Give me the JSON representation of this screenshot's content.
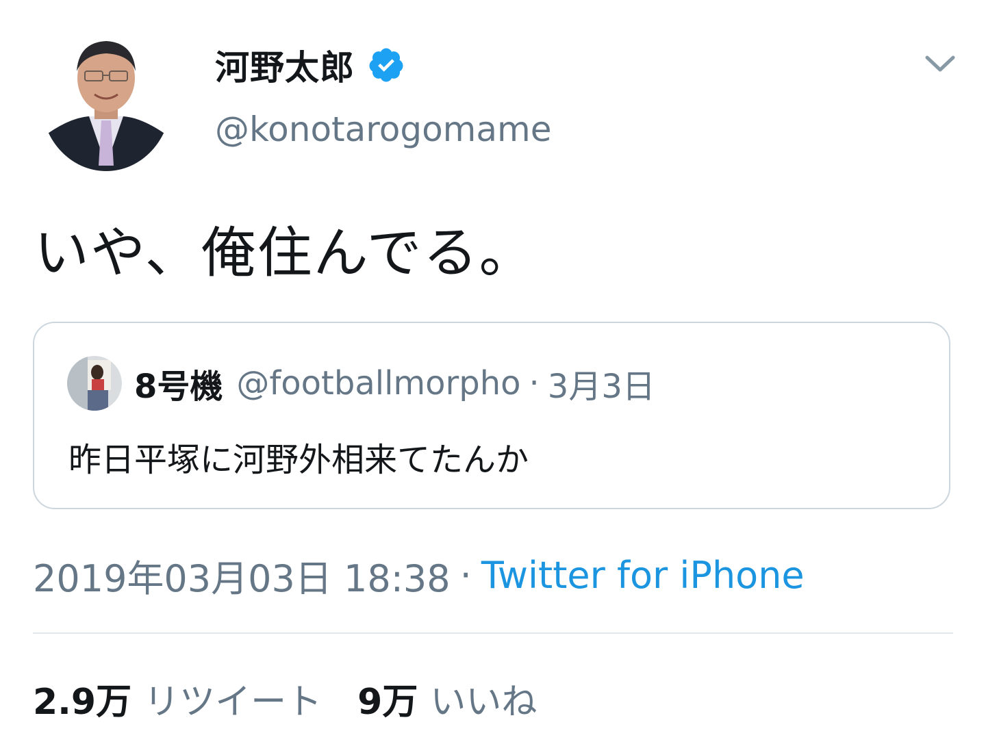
{
  "author": {
    "display_name": "河野太郎",
    "handle": "@konotarogomame",
    "verified": true,
    "verified_icon": "verified-badge-icon"
  },
  "tweet": {
    "text": "いや、俺住んでる。"
  },
  "quoted_tweet": {
    "display_name": "8号機",
    "handle": "@footballmorpho",
    "separator": "·",
    "date": "3月3日",
    "text": "昨日平塚に河野外相来てたんか"
  },
  "meta": {
    "timestamp": "2019年03月03日 18:38",
    "separator": "·",
    "source": "Twitter for iPhone"
  },
  "stats": {
    "retweet_count": "2.9万",
    "retweet_label": "リツイート",
    "like_count": "9万",
    "like_label": "いいね"
  },
  "colors": {
    "text_primary": "#14171a",
    "text_secondary": "#657786",
    "link": "#1b95e0",
    "verified": "#1da1f2",
    "border": "#ccd6dd"
  }
}
